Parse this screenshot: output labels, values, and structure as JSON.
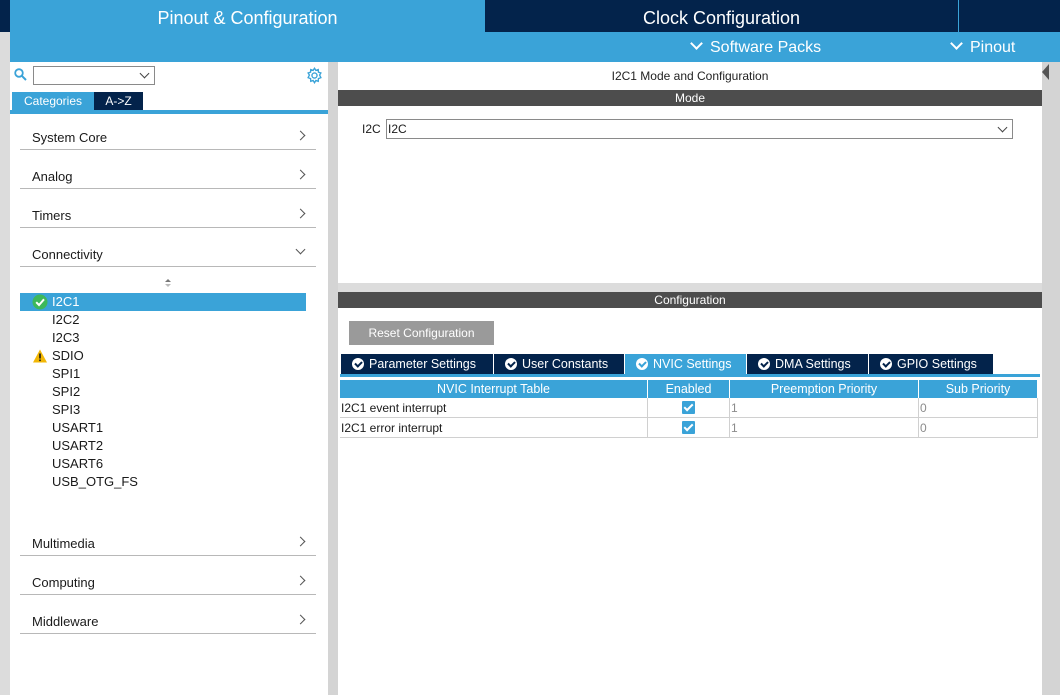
{
  "top_tabs": {
    "pinout_config": "Pinout & Configuration",
    "clock_config": "Clock Configuration"
  },
  "sub_menu": {
    "software_packs": "Software Packs",
    "pinout": "Pinout"
  },
  "left": {
    "search_value": "",
    "tabs": {
      "categories": "Categories",
      "az": "A->Z"
    },
    "categories": [
      {
        "label": "System Core",
        "expanded": false
      },
      {
        "label": "Analog",
        "expanded": false
      },
      {
        "label": "Timers",
        "expanded": false
      },
      {
        "label": "Connectivity",
        "expanded": true
      },
      {
        "label": "Multimedia",
        "expanded": false
      },
      {
        "label": "Computing",
        "expanded": false
      },
      {
        "label": "Middleware",
        "expanded": false
      }
    ],
    "peripherals": [
      {
        "label": "I2C1",
        "status": "ok",
        "selected": true
      },
      {
        "label": "I2C2",
        "status": "",
        "selected": false
      },
      {
        "label": "I2C3",
        "status": "",
        "selected": false
      },
      {
        "label": "SDIO",
        "status": "warning",
        "selected": false
      },
      {
        "label": "SPI1",
        "status": "",
        "selected": false
      },
      {
        "label": "SPI2",
        "status": "",
        "selected": false
      },
      {
        "label": "SPI3",
        "status": "",
        "selected": false
      },
      {
        "label": "USART1",
        "status": "",
        "selected": false
      },
      {
        "label": "USART2",
        "status": "",
        "selected": false
      },
      {
        "label": "USART6",
        "status": "",
        "selected": false
      },
      {
        "label": "USB_OTG_FS",
        "status": "",
        "selected": false
      }
    ]
  },
  "mode_panel": {
    "title": "I2C1 Mode and Configuration",
    "mode_header": "Mode",
    "i2c_label": "I2C",
    "i2c_value": "I2C"
  },
  "config_panel": {
    "header": "Configuration",
    "reset_button": "Reset Configuration",
    "tabs": [
      {
        "label": "Parameter Settings",
        "active": false
      },
      {
        "label": "User Constants",
        "active": false
      },
      {
        "label": "NVIC Settings",
        "active": true
      },
      {
        "label": "DMA Settings",
        "active": false
      },
      {
        "label": "GPIO Settings",
        "active": false
      }
    ],
    "table": {
      "headers": [
        "NVIC Interrupt Table",
        "Enabled",
        "Preemption Priority",
        "Sub Priority"
      ],
      "rows": [
        {
          "name": "I2C1 event interrupt",
          "enabled": true,
          "preemption": "1",
          "sub": "0"
        },
        {
          "name": "I2C1 error interrupt",
          "enabled": true,
          "preemption": "1",
          "sub": "0"
        }
      ]
    }
  },
  "colors": {
    "accent": "#3aa3d8",
    "navy": "#03234b",
    "dark_bar": "#4d4d4d",
    "ok_green": "#3db85b",
    "warning_yellow": "#f2b705"
  }
}
